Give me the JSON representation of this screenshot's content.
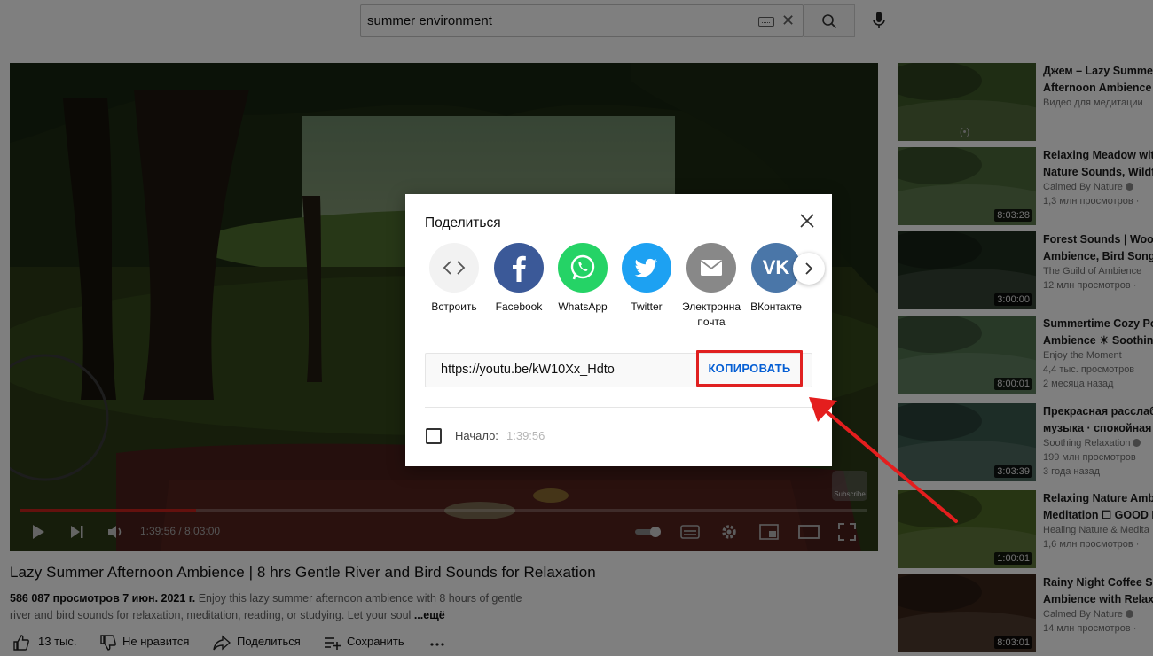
{
  "search": {
    "query": "summer environment",
    "keyboard_icon": "keyboard-icon",
    "clear_icon": "close-icon",
    "search_icon": "search-icon",
    "mic_icon": "mic-icon"
  },
  "player": {
    "time_current": "1:39:56",
    "time_total": "8:03:00",
    "time_display": "1:39:56 / 8:03:00",
    "progress_fraction": 0.207,
    "subscribe_badge": "Subscribe"
  },
  "video": {
    "title": "Lazy Summer Afternoon Ambience | 8 hrs Gentle River and Bird Sounds for Relaxation",
    "views": "586 087 просмотров",
    "date": "7 июн. 2021 г.",
    "description": "Enjoy this lazy summer afternoon ambience with 8 hours of gentle river and bird sounds for relaxation, meditation, reading, or studying. Let your soul",
    "more": "...ещё",
    "actions": {
      "like": "13 тыс.",
      "dislike": "Не нравится",
      "share": "Поделиться",
      "save": "Сохранить",
      "more_icon": "more-icon"
    }
  },
  "share_dialog": {
    "title": "Поделиться",
    "targets": [
      {
        "label": "Встроить",
        "icon": "embed-icon",
        "color": "#f2f2f2"
      },
      {
        "label": "Facebook",
        "icon": "facebook-icon",
        "color": "#3b5998"
      },
      {
        "label": "WhatsApp",
        "icon": "whatsapp-icon",
        "color": "#25d366"
      },
      {
        "label": "Twitter",
        "icon": "twitter-icon",
        "color": "#1da1f2"
      },
      {
        "label_line1": "Электронна",
        "label_line2": "почта",
        "icon": "email-icon",
        "color": "#888888"
      },
      {
        "label": "ВКонтакте",
        "icon": "vk-icon",
        "color": "#4a76a8"
      }
    ],
    "url": "https://youtu.be/kW10Xx_Hdto",
    "copy_label": "КОПИРОВАТЬ",
    "start_label": "Начало:",
    "start_time": "1:39:56"
  },
  "sidebar": {
    "items": [
      {
        "title1": "Джем – Lazy Summe",
        "title2": "Afternoon Ambience",
        "channel": "Видео для медитации",
        "meta": "",
        "meta2": "",
        "duration": "",
        "live": "(•)",
        "verified": false,
        "thumb": "#3f5a28"
      },
      {
        "title1": "Relaxing Meadow wit",
        "title2": "Nature Sounds, Wildf",
        "channel": "Calmed By Nature",
        "meta": "1,3 млн просмотров ·",
        "meta2": "",
        "duration": "8:03:28",
        "live": "",
        "verified": true,
        "thumb": "#4d6b3a"
      },
      {
        "title1": "Forest Sounds | Woo",
        "title2": "Ambience, Bird Song",
        "channel": "The Guild of Ambience",
        "meta": "12 млн просмотров ·",
        "meta2": "",
        "duration": "3:00:00",
        "live": "",
        "verified": false,
        "thumb": "#1f2e1e"
      },
      {
        "title1": "Summertime Cozy Po",
        "title2": "Ambience ☀ Soothin",
        "channel": "Enjoy the Moment",
        "meta": "4,4 тыс. просмотров",
        "meta2": "2 месяца назад",
        "duration": "8:00:01",
        "live": "",
        "verified": false,
        "thumb": "#50724e"
      },
      {
        "title1": "Прекрасная расслаб",
        "title2": "музыка · спокойная",
        "channel": "Soothing Relaxation",
        "meta": "199 млн просмотров",
        "meta2": "3 года назад",
        "duration": "3:03:39",
        "live": "",
        "verified": true,
        "thumb": "#3a5a4e"
      },
      {
        "title1": "Relaxing Nature Amb",
        "title2": "Meditation ☐ GOOD M",
        "channel": "Healing Nature & Medita",
        "meta": "1,6 млн просмотров ·",
        "meta2": "",
        "duration": "1:00:01",
        "live": "",
        "verified": false,
        "thumb": "#4f6a26"
      },
      {
        "title1": "Rainy Night Coffee Sh",
        "title2": "Ambience with Relax",
        "channel": "Calmed By Nature",
        "meta": "14 млн просмотров ·",
        "meta2": "",
        "duration": "8:03:01",
        "live": "",
        "verified": true,
        "thumb": "#3a2418"
      }
    ]
  },
  "annotation": {
    "highlight_color": "#e02020"
  }
}
